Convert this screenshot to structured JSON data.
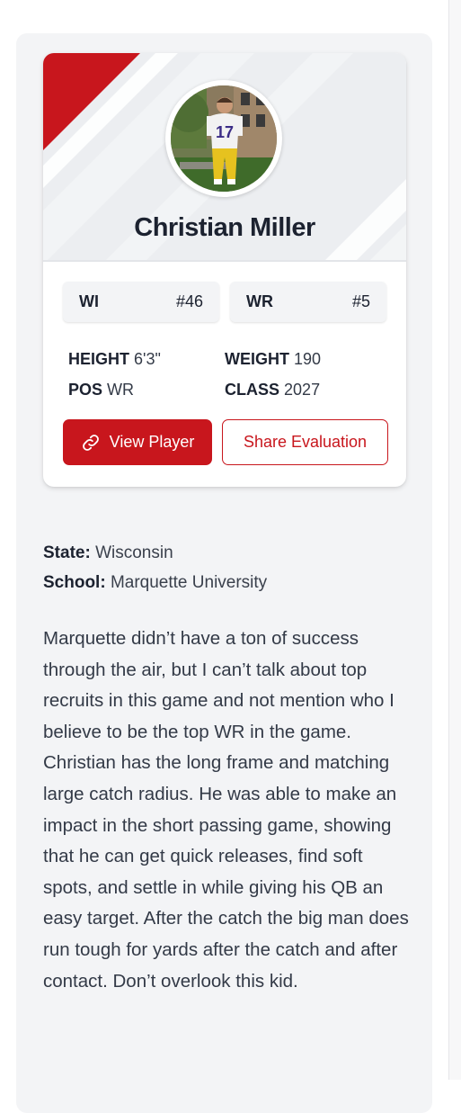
{
  "player": {
    "name": "Christian Miller",
    "photo_alt": "player photo"
  },
  "rankings": {
    "state": {
      "label": "WI",
      "rank": "#46"
    },
    "position": {
      "label": "WR",
      "rank": "#5"
    }
  },
  "stats": {
    "height": {
      "key": "HEIGHT",
      "value": "6'3\""
    },
    "weight": {
      "key": "WEIGHT",
      "value": "190"
    },
    "pos": {
      "key": "POS",
      "value": "WR"
    },
    "class": {
      "key": "CLASS",
      "value": "2027"
    }
  },
  "actions": {
    "view_player": "View Player",
    "share_evaluation": "Share Evaluation"
  },
  "details": {
    "state_key": "State:",
    "state_value": "Wisconsin",
    "school_key": "School:",
    "school_value": "Marquette University"
  },
  "evaluation": "Marquette didn’t have a ton of success through the air, but I can’t talk about top recruits in this game and not mention who I believe to be the top WR in the game. Christian has the long frame and matching large catch radius. He was able to make an impact in the short passing game, showing that he can get quick releases, find soft spots, and settle in while giving his QB an easy target. After the catch the big man does run tough for yards after the catch and after contact. Don’t overlook this kid.",
  "colors": {
    "accent": "#c8161d",
    "text": "#1c2230",
    "panel": "#f3f4f6"
  },
  "icons": {
    "view_player": "link-icon"
  }
}
